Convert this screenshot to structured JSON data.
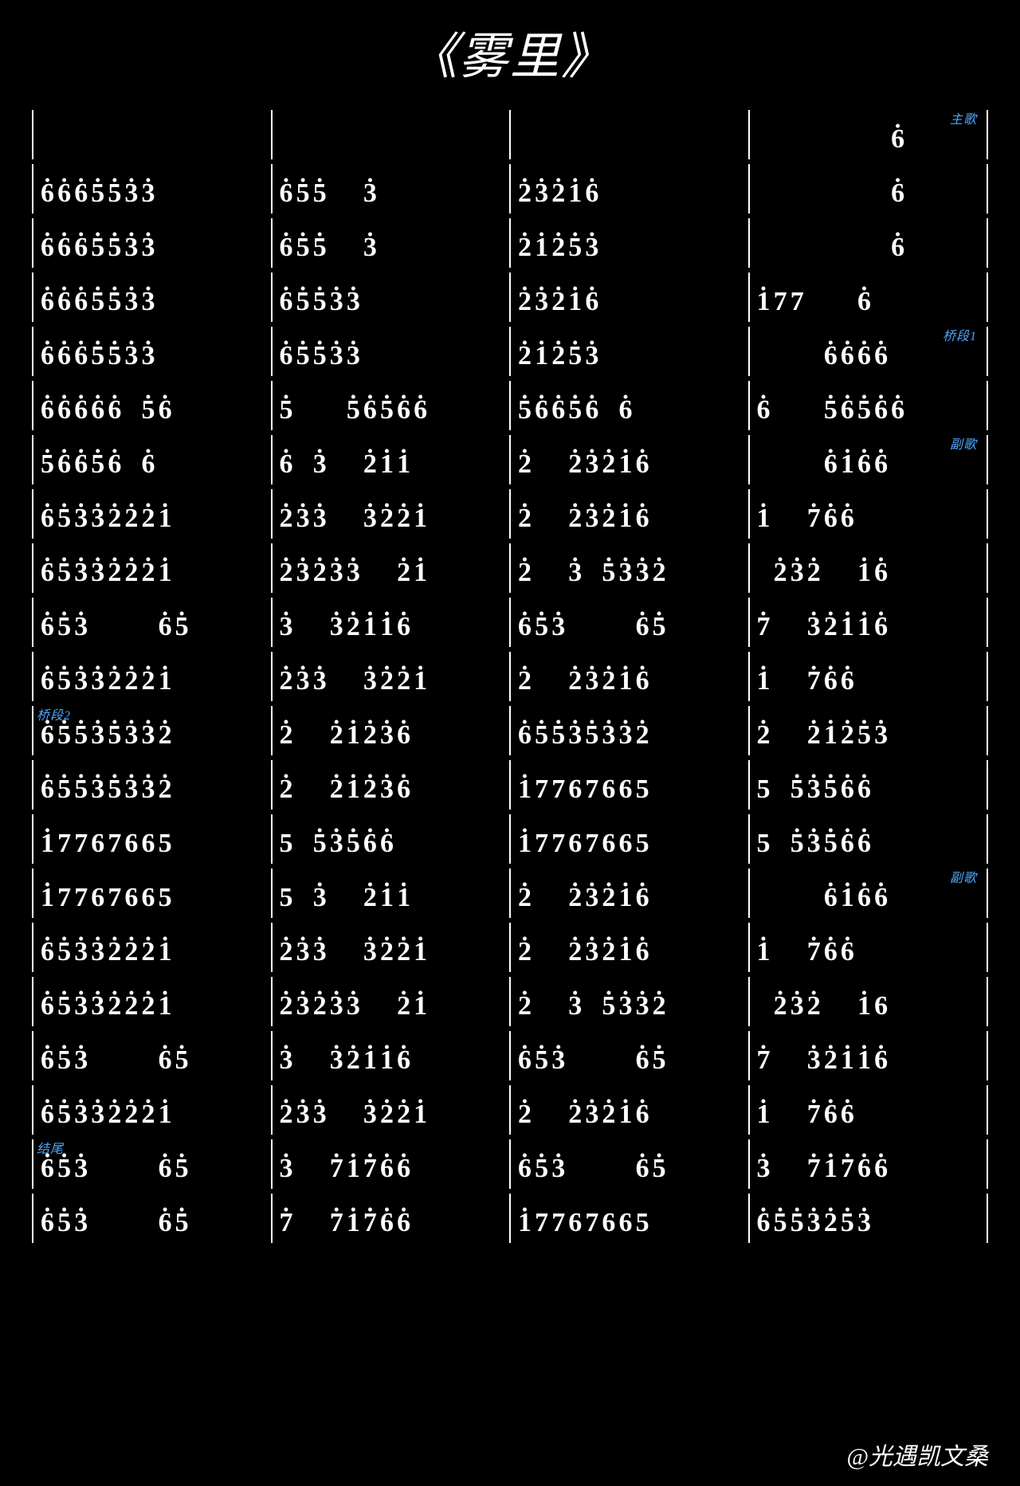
{
  "title": "《雾里》",
  "footer": "@光遇凯文桑",
  "labels": {
    "zhuge": "主歌",
    "qiaoduan1": "桥段1",
    "fuge": "副歌",
    "qiaoduan2": "桥段2",
    "fuge2": "副歌",
    "jiewei": "结尾"
  },
  "rows": [
    {
      "bars": [
        {
          "notes": ""
        },
        {
          "notes": ""
        },
        {
          "notes": ""
        },
        {
          "notes": "        6̇",
          "label": "zhuge",
          "labelPos": "right"
        }
      ]
    },
    {
      "bars": [
        {
          "notes": "6̇6̇6̇5̇5̇3̇3̇"
        },
        {
          "notes": "6̇5̇5̇  3̇"
        },
        {
          "notes": "2̇3̇2̇1̇6̇"
        },
        {
          "notes": "        6̇"
        }
      ]
    },
    {
      "bars": [
        {
          "notes": "6̇6̇6̇5̇5̇3̇3̇"
        },
        {
          "notes": "6̇5̇5̇  3̇"
        },
        {
          "notes": "2̇1̇2̇5̇3̇"
        },
        {
          "notes": "        6̇"
        }
      ]
    },
    {
      "bars": [
        {
          "notes": "6̇6̇6̇5̇5̇3̇3̇"
        },
        {
          "notes": "6̇5̇5̇3̇3̇"
        },
        {
          "notes": "2̇3̇2̇1̇6̇"
        },
        {
          "notes": "1̇77   6̇"
        }
      ]
    },
    {
      "bars": [
        {
          "notes": "6̇6̇6̇5̇5̇3̇3̇"
        },
        {
          "notes": "6̇5̇5̇3̇3̇"
        },
        {
          "notes": "2̇1̇2̇5̇3̇"
        },
        {
          "notes": "    6̇6̇6̇6̇",
          "label": "qiaoduan1",
          "labelPos": "right"
        }
      ]
    },
    {
      "bars": [
        {
          "notes": "6̇6̇6̇6̇6̇ 5̇6̇"
        },
        {
          "notes": "5̇   5̇6̇5̇6̇6̇"
        },
        {
          "notes": "5̇6̇6̇5̇6̇ 6̇ "
        },
        {
          "notes": "6̇   5̇6̇5̇6̇6̇"
        }
      ]
    },
    {
      "bars": [
        {
          "notes": "5̇6̇6̇5̇6̇ 6̇"
        },
        {
          "notes": "6̇ 3̇  2̇1̇1̇ "
        },
        {
          "notes": "2̇  2̇3̇2̇1̇6̇"
        },
        {
          "notes": "    6̇1̇6̇6̇",
          "label": "fuge",
          "labelPos": "right"
        }
      ]
    },
    {
      "bars": [
        {
          "notes": "6̇5̇3̇3̇2̇2̇2̇1̇"
        },
        {
          "notes": "2̇3̇3̇  3̇2̇2̇1̇"
        },
        {
          "notes": "2̇  2̇3̇2̇1̇6̇"
        },
        {
          "notes": "1̇  7̇6̇6̇"
        }
      ]
    },
    {
      "bars": [
        {
          "notes": "6̇5̇3̇3̇2̇2̇2̇1̇"
        },
        {
          "notes": "2̇3̇2̇3̇3̇  2̇1̇"
        },
        {
          "notes": "2̇  3̇ 5̇3̇3̇2̇"
        },
        {
          "notes": " 2̇3̇2̇  1̇6̇"
        }
      ]
    },
    {
      "bars": [
        {
          "notes": "6̇5̇3̇    6̇5̇"
        },
        {
          "notes": "3̇  3̇2̇1̇1̇6̇"
        },
        {
          "notes": "6̇5̇3̇    6̇5̇"
        },
        {
          "notes": "7̇  3̇2̇1̇1̇6̇"
        }
      ]
    },
    {
      "bars": [
        {
          "notes": "6̇5̇3̇3̇2̇2̇2̇1̇"
        },
        {
          "notes": "2̇3̇3̇  3̇2̇2̇1̇"
        },
        {
          "notes": "2̇  2̇3̇2̇1̇6̇"
        },
        {
          "notes": "1̇  7̇6̇6̇"
        }
      ]
    },
    {
      "bars": [
        {
          "notes": "6̇5̇5̇3̇5̇3̇3̇2̇",
          "label": "qiaoduan2",
          "labelPos": "left"
        },
        {
          "notes": "2̇  2̇1̇2̇3̇6̇"
        },
        {
          "notes": "6̇5̇5̇3̇5̇3̇3̇2̇"
        },
        {
          "notes": "2̇  2̇1̇2̇5̇3̇"
        }
      ]
    },
    {
      "bars": [
        {
          "notes": "6̇5̇5̇3̇5̇3̇3̇2̇"
        },
        {
          "notes": "2̇  2̇1̇2̇3̇6̇"
        },
        {
          "notes": "1̇7767665"
        },
        {
          "notes": "5 5̇3̇5̇6̇6̇"
        }
      ]
    },
    {
      "bars": [
        {
          "notes": "1̇7767665"
        },
        {
          "notes": "5 5̇3̇5̇6̇6̇"
        },
        {
          "notes": "1̇7767665"
        },
        {
          "notes": "5 5̇3̇5̇6̇6̇"
        }
      ]
    },
    {
      "bars": [
        {
          "notes": "1̇7767665"
        },
        {
          "notes": "5 3̇  2̇1̇1̇"
        },
        {
          "notes": "2̇  2̇3̇2̇1̇6̇"
        },
        {
          "notes": "    6̇1̇6̇6̇",
          "label": "fuge2",
          "labelPos": "right"
        }
      ]
    },
    {
      "bars": [
        {
          "notes": "6̇5̇3̇3̇2̇2̇2̇1̇"
        },
        {
          "notes": "2̇3̇3̇  3̇2̇2̇1̇"
        },
        {
          "notes": "2̇  2̇3̇2̇1̇6̇"
        },
        {
          "notes": "1̇  7̇6̇6̇"
        }
      ]
    },
    {
      "bars": [
        {
          "notes": "6̇5̇3̇3̇2̇2̇2̇1̇"
        },
        {
          "notes": "2̇3̇2̇3̇3̇  2̇1̇"
        },
        {
          "notes": "2̇  3̇ 5̇3̇3̇2̇"
        },
        {
          "notes": " 2̇3̇2̇  1̇6"
        }
      ]
    },
    {
      "bars": [
        {
          "notes": "6̇5̇3̇    6̇5̇"
        },
        {
          "notes": "3̇  3̇2̇1̇1̇6̇"
        },
        {
          "notes": "6̇5̇3̇    6̇5̇"
        },
        {
          "notes": "7̇  3̇2̇1̇1̇6̇"
        }
      ]
    },
    {
      "bars": [
        {
          "notes": "6̇5̇3̇3̇2̇2̇2̇1̇"
        },
        {
          "notes": "2̇3̇3̇  3̇2̇2̇1̇"
        },
        {
          "notes": "2̇  2̇3̇2̇1̇6̇"
        },
        {
          "notes": "1̇  7̇6̇6̇"
        }
      ]
    },
    {
      "bars": [
        {
          "notes": "6̇5̇3̇    6̇5̇",
          "label": "jiewei",
          "labelPos": "left"
        },
        {
          "notes": "3̇  7̇1̇7̇6̇6̇"
        },
        {
          "notes": "6̇5̇3̇    6̇5̇"
        },
        {
          "notes": "3̇  7̇1̇7̇6̇6̇"
        }
      ]
    },
    {
      "bars": [
        {
          "notes": "6̇5̇3̇    6̇5̇"
        },
        {
          "notes": "7̇  7̇1̇7̇6̇6̇"
        },
        {
          "notes": "1̇7767665"
        },
        {
          "notes": "6̇5̇5̇3̇2̇5̇3̇"
        }
      ]
    }
  ]
}
